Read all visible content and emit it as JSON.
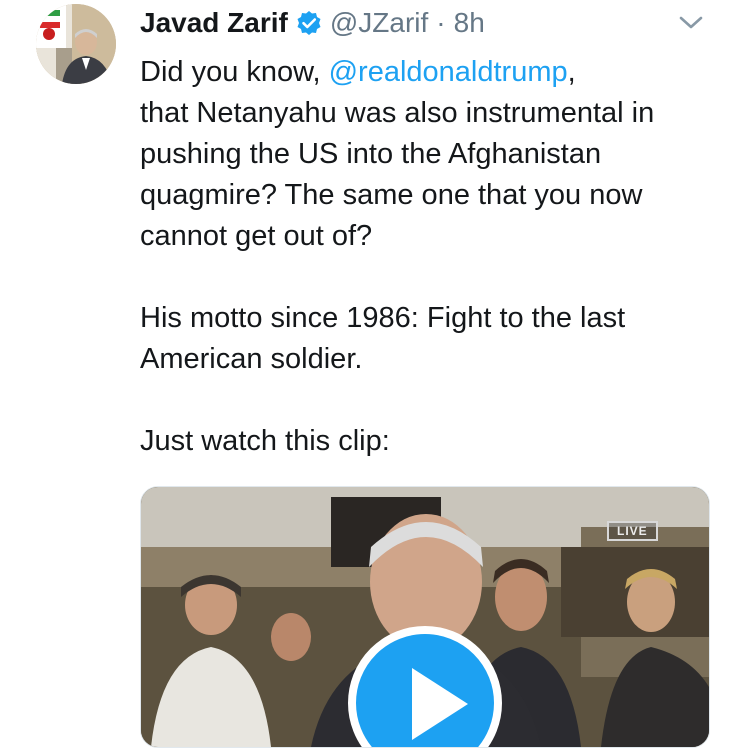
{
  "tweet": {
    "author": {
      "name": "Javad Zarif",
      "handle": "@JZarif",
      "verified": true,
      "avatar": "profile-photo"
    },
    "separator": "·",
    "time": "8h",
    "menu_icon": "chevron-down-icon",
    "text": {
      "line1_prefix": "Did you know, ",
      "mention": "@realdonaldtrump",
      "line1_suffix": ",",
      "para1_rest": "that Netanyahu was also instrumental in pushing the US into the Afghanistan quagmire? The same one that you now cannot get out of?",
      "para2": "His motto since 1986: Fight to the last American soldier.",
      "para3": "Just watch this clip:"
    },
    "media": {
      "type": "video",
      "live_badge": "LIVE",
      "play_icon": "play-icon"
    }
  },
  "colors": {
    "accent": "#1da1f2",
    "text": "#14171a",
    "secondary": "#657786"
  }
}
